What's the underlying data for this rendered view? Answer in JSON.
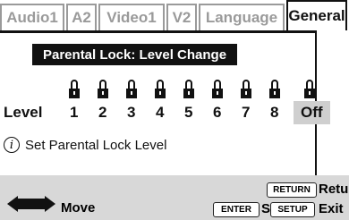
{
  "tabs": [
    {
      "label": "Audio1",
      "active": false
    },
    {
      "label": "A2",
      "active": false
    },
    {
      "label": "Video1",
      "active": false
    },
    {
      "label": "V2",
      "active": false
    },
    {
      "label": "Language",
      "active": false
    },
    {
      "label": "General",
      "active": true
    }
  ],
  "heading": "Parental Lock: Level Change",
  "level_label": "Level",
  "levels": [
    "1",
    "2",
    "3",
    "4",
    "5",
    "6",
    "7",
    "8",
    "Off"
  ],
  "selected_level": "Off",
  "info_text": "Set Parental Lock Level",
  "footer": {
    "move": "Move",
    "enter_key": "ENTER",
    "select": "Select",
    "return_key": "RETURN",
    "return_label": "Return",
    "setup_key": "SETUP",
    "exit": "Exit"
  }
}
